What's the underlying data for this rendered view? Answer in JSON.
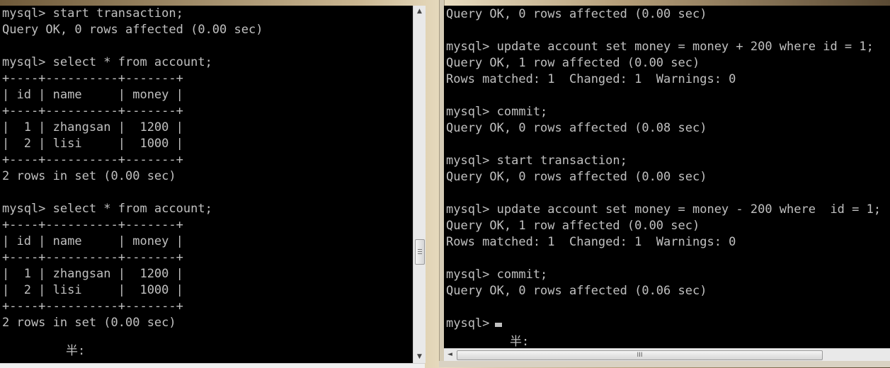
{
  "left_terminal": {
    "lines": [
      "mysql> start transaction;",
      "Query OK, 0 rows affected (0.00 sec)",
      "",
      "mysql> select * from account;",
      "+----+----------+-------+",
      "| id | name     | money |",
      "+----+----------+-------+",
      "|  1 | zhangsan |  1200 |",
      "|  2 | lisi     |  1000 |",
      "+----+----------+-------+",
      "2 rows in set (0.00 sec)",
      "",
      "mysql> select * from account;",
      "+----+----------+-------+",
      "| id | name     | money |",
      "+----+----------+-------+",
      "|  1 | zhangsan |  1200 |",
      "|  2 | lisi     |  1000 |",
      "+----+----------+-------+",
      "2 rows in set (0.00 sec)"
    ],
    "ime_indicator": "半:"
  },
  "right_terminal": {
    "lines": [
      "Query OK, 0 rows affected (0.00 sec)",
      "",
      "mysql> update account set money = money + 200 where id = 1;",
      "Query OK, 1 row affected (0.00 sec)",
      "Rows matched: 1  Changed: 1  Warnings: 0",
      "",
      "mysql> commit;",
      "Query OK, 0 rows affected (0.08 sec)",
      "",
      "mysql> start transaction;",
      "Query OK, 0 rows affected (0.00 sec)",
      "",
      "mysql> update account set money = money - 200 where  id = 1;",
      "Query OK, 1 row affected (0.00 sec)",
      "Rows matched: 1  Changed: 1  Warnings: 0",
      "",
      "mysql> commit;",
      "Query OK, 0 rows affected (0.06 sec)",
      ""
    ],
    "prompt": "mysql>",
    "ime_indicator": "半:"
  },
  "scrollbars": {
    "up_arrow_icon": "▲",
    "down_arrow_icon": "▼",
    "left_arrow_icon": "◄",
    "thumb_grip": "III"
  },
  "colors": {
    "terminal_bg": "#000000",
    "terminal_fg": "#c0c0c0"
  }
}
